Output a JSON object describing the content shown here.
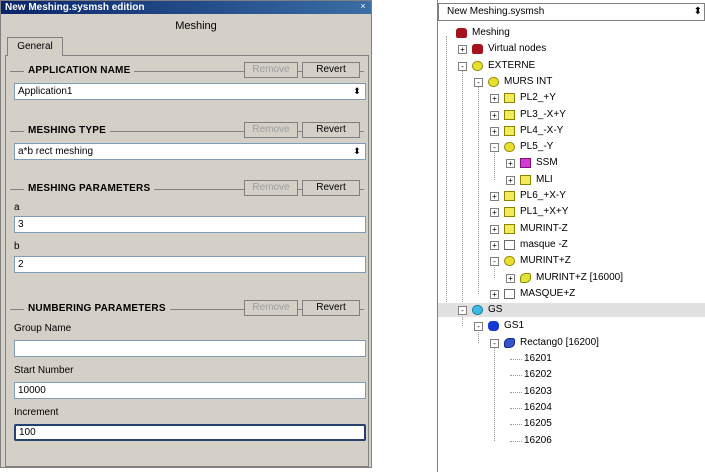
{
  "dialog": {
    "title": "New Meshing.sysmsh edition",
    "close_glyph": "×",
    "heading": "Meshing",
    "tab": "General",
    "sections": {
      "application": {
        "title": "APPLICATION NAME",
        "remove": "Remove",
        "revert": "Revert",
        "value": "Application1"
      },
      "meshing_type": {
        "title": "MESHING TYPE",
        "remove": "Remove",
        "revert": "Revert",
        "value": "a*b rect meshing"
      },
      "meshing_params": {
        "title": "MESHING PARAMETERS",
        "remove": "Remove",
        "revert": "Revert",
        "a_label": "a",
        "a_value": "3",
        "b_label": "b",
        "b_value": "2"
      },
      "numbering": {
        "title": "NUMBERING PARAMETERS",
        "remove": "Remove",
        "revert": "Revert",
        "group_label": "Group Name",
        "group_value": "",
        "start_label": "Start Number",
        "start_value": "10000",
        "increment_label": "Increment",
        "increment_value": "100"
      }
    },
    "combo_arrow": "⬍"
  },
  "tree": {
    "selector": "New Meshing.sysmsh",
    "selector_arrow": "⬍",
    "nodes": [
      {
        "label": "Meshing",
        "icon": "db-red-icon"
      },
      {
        "label": "Virtual nodes",
        "icon": "box-red-icon",
        "expander": "+"
      },
      {
        "label": "EXTERNE",
        "icon": "db-yellow-icon",
        "expander": "-"
      },
      {
        "label": "MURS INT",
        "icon": "db-yellow-icon",
        "expander": "-"
      },
      {
        "label": "PL2_+Y",
        "icon": "box-yellow-icon",
        "expander": "+"
      },
      {
        "label": "PL3_-X+Y",
        "icon": "box-yellow-icon",
        "expander": "+"
      },
      {
        "label": "PL4_-X-Y",
        "icon": "box-yellow-icon",
        "expander": "+"
      },
      {
        "label": "PL5_-Y",
        "icon": "db-yellow-icon",
        "expander": "-"
      },
      {
        "label": "SSM",
        "icon": "box-magenta-icon",
        "expander": "+"
      },
      {
        "label": "MLI",
        "icon": "box-yellow-icon",
        "expander": "+"
      },
      {
        "label": "PL6_+X-Y",
        "icon": "box-yellow-icon",
        "expander": "+"
      },
      {
        "label": "PL1_+X+Y",
        "icon": "box-yellow-icon",
        "expander": "+"
      },
      {
        "label": "MURINT-Z",
        "icon": "box-yellow-icon",
        "expander": "+"
      },
      {
        "label": "masque -Z",
        "icon": "box-white-icon",
        "expander": "+"
      },
      {
        "label": "MURINT+Z",
        "icon": "db-yellow-icon",
        "expander": "-"
      },
      {
        "label": "MURINT+Z [16000]",
        "icon": "shape-yellow-icon",
        "expander": "+"
      },
      {
        "label": "MASQUE+Z",
        "icon": "box-white-icon",
        "expander": "+"
      },
      {
        "label": "GS",
        "icon": "db-cyan-icon",
        "expander": "-"
      },
      {
        "label": "GS1",
        "icon": "db-blue-icon",
        "expander": "-"
      },
      {
        "label": "Rectang0 [16200]",
        "icon": "shape-blue-icon",
        "expander": "-"
      },
      {
        "label": "16201"
      },
      {
        "label": "16202"
      },
      {
        "label": "16203"
      },
      {
        "label": "16204"
      },
      {
        "label": "16205"
      },
      {
        "label": "16206"
      }
    ]
  }
}
